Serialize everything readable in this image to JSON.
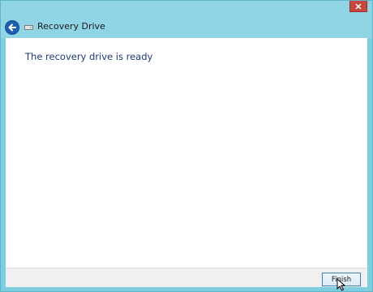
{
  "window": {
    "title": "Recovery Drive"
  },
  "content": {
    "heading": "The recovery drive is ready"
  },
  "footer": {
    "finish_label": "Finish"
  },
  "icons": {
    "back": "back-arrow-icon",
    "drive": "drive-icon",
    "close": "close-icon",
    "cursor": "mouse-pointer-icon"
  },
  "colors": {
    "frame": "#8fd5e6",
    "close_button": "#c7473c",
    "back_button": "#1f5fb0",
    "heading_text": "#1e3a78"
  }
}
